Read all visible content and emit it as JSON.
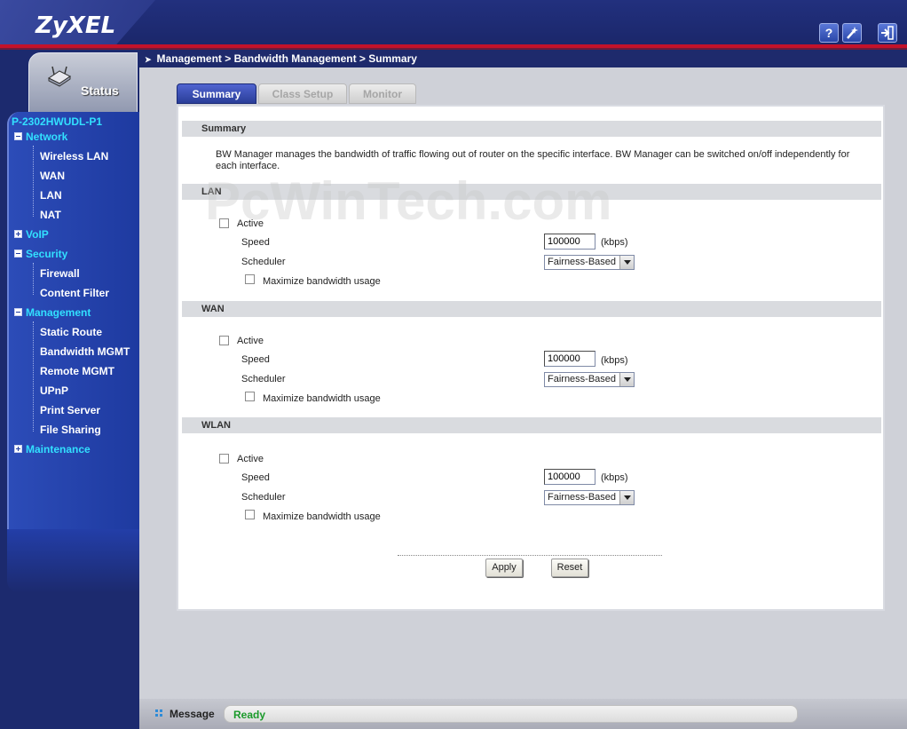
{
  "header": {
    "logo": "ZyXEL",
    "help_icon": "?",
    "wizard_icon": "wand-icon",
    "logout_icon": "logout-icon"
  },
  "sidebar": {
    "status_label": "Status",
    "device": "P-2302HWUDL-P1",
    "menu": [
      {
        "label": "Network",
        "expanded": true,
        "children": [
          "Wireless LAN",
          "WAN",
          "LAN",
          "NAT"
        ]
      },
      {
        "label": "VoIP",
        "expanded": false,
        "children": []
      },
      {
        "label": "Security",
        "expanded": true,
        "children": [
          "Firewall",
          "Content Filter"
        ]
      },
      {
        "label": "Management",
        "expanded": true,
        "children": [
          "Static Route",
          "Bandwidth MGMT",
          "Remote MGMT",
          "UPnP",
          "Print Server",
          "File Sharing"
        ]
      },
      {
        "label": "Maintenance",
        "expanded": false,
        "children": []
      }
    ]
  },
  "breadcrumb": "Management > Bandwidth Management > Summary",
  "tabs": [
    "Summary",
    "Class Setup",
    "Monitor"
  ],
  "summary": {
    "heading": "Summary",
    "description": "BW Manager manages the bandwidth of traffic flowing out of router on the specific interface. BW Manager can be switched on/off independently for each interface."
  },
  "interfaces": [
    {
      "name": "LAN",
      "active_label": "Active",
      "speed_label": "Speed",
      "speed": "100000",
      "unit": "(kbps)",
      "scheduler_label": "Scheduler",
      "scheduler": "Fairness-Based",
      "maximize_label": "Maximize bandwidth usage"
    },
    {
      "name": "WAN",
      "active_label": "Active",
      "speed_label": "Speed",
      "speed": "100000",
      "unit": "(kbps)",
      "scheduler_label": "Scheduler",
      "scheduler": "Fairness-Based",
      "maximize_label": "Maximize bandwidth usage"
    },
    {
      "name": "WLAN",
      "active_label": "Active",
      "speed_label": "Speed",
      "speed": "100000",
      "unit": "(kbps)",
      "scheduler_label": "Scheduler",
      "scheduler": "Fairness-Based",
      "maximize_label": "Maximize bandwidth usage"
    }
  ],
  "buttons": {
    "apply": "Apply",
    "reset": "Reset"
  },
  "watermark": "PcWinTech.com",
  "message": {
    "label": "Message",
    "value": "Ready"
  }
}
